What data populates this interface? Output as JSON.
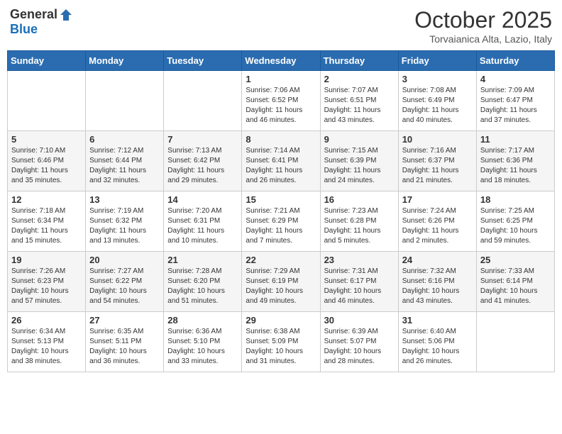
{
  "header": {
    "logo_general": "General",
    "logo_blue": "Blue",
    "month_title": "October 2025",
    "location": "Torvaianica Alta, Lazio, Italy"
  },
  "weekdays": [
    "Sunday",
    "Monday",
    "Tuesday",
    "Wednesday",
    "Thursday",
    "Friday",
    "Saturday"
  ],
  "weeks": [
    [
      {
        "day": "",
        "info": ""
      },
      {
        "day": "",
        "info": ""
      },
      {
        "day": "",
        "info": ""
      },
      {
        "day": "1",
        "info": "Sunrise: 7:06 AM\nSunset: 6:52 PM\nDaylight: 11 hours\nand 46 minutes."
      },
      {
        "day": "2",
        "info": "Sunrise: 7:07 AM\nSunset: 6:51 PM\nDaylight: 11 hours\nand 43 minutes."
      },
      {
        "day": "3",
        "info": "Sunrise: 7:08 AM\nSunset: 6:49 PM\nDaylight: 11 hours\nand 40 minutes."
      },
      {
        "day": "4",
        "info": "Sunrise: 7:09 AM\nSunset: 6:47 PM\nDaylight: 11 hours\nand 37 minutes."
      }
    ],
    [
      {
        "day": "5",
        "info": "Sunrise: 7:10 AM\nSunset: 6:46 PM\nDaylight: 11 hours\nand 35 minutes."
      },
      {
        "day": "6",
        "info": "Sunrise: 7:12 AM\nSunset: 6:44 PM\nDaylight: 11 hours\nand 32 minutes."
      },
      {
        "day": "7",
        "info": "Sunrise: 7:13 AM\nSunset: 6:42 PM\nDaylight: 11 hours\nand 29 minutes."
      },
      {
        "day": "8",
        "info": "Sunrise: 7:14 AM\nSunset: 6:41 PM\nDaylight: 11 hours\nand 26 minutes."
      },
      {
        "day": "9",
        "info": "Sunrise: 7:15 AM\nSunset: 6:39 PM\nDaylight: 11 hours\nand 24 minutes."
      },
      {
        "day": "10",
        "info": "Sunrise: 7:16 AM\nSunset: 6:37 PM\nDaylight: 11 hours\nand 21 minutes."
      },
      {
        "day": "11",
        "info": "Sunrise: 7:17 AM\nSunset: 6:36 PM\nDaylight: 11 hours\nand 18 minutes."
      }
    ],
    [
      {
        "day": "12",
        "info": "Sunrise: 7:18 AM\nSunset: 6:34 PM\nDaylight: 11 hours\nand 15 minutes."
      },
      {
        "day": "13",
        "info": "Sunrise: 7:19 AM\nSunset: 6:32 PM\nDaylight: 11 hours\nand 13 minutes."
      },
      {
        "day": "14",
        "info": "Sunrise: 7:20 AM\nSunset: 6:31 PM\nDaylight: 11 hours\nand 10 minutes."
      },
      {
        "day": "15",
        "info": "Sunrise: 7:21 AM\nSunset: 6:29 PM\nDaylight: 11 hours\nand 7 minutes."
      },
      {
        "day": "16",
        "info": "Sunrise: 7:23 AM\nSunset: 6:28 PM\nDaylight: 11 hours\nand 5 minutes."
      },
      {
        "day": "17",
        "info": "Sunrise: 7:24 AM\nSunset: 6:26 PM\nDaylight: 11 hours\nand 2 minutes."
      },
      {
        "day": "18",
        "info": "Sunrise: 7:25 AM\nSunset: 6:25 PM\nDaylight: 10 hours\nand 59 minutes."
      }
    ],
    [
      {
        "day": "19",
        "info": "Sunrise: 7:26 AM\nSunset: 6:23 PM\nDaylight: 10 hours\nand 57 minutes."
      },
      {
        "day": "20",
        "info": "Sunrise: 7:27 AM\nSunset: 6:22 PM\nDaylight: 10 hours\nand 54 minutes."
      },
      {
        "day": "21",
        "info": "Sunrise: 7:28 AM\nSunset: 6:20 PM\nDaylight: 10 hours\nand 51 minutes."
      },
      {
        "day": "22",
        "info": "Sunrise: 7:29 AM\nSunset: 6:19 PM\nDaylight: 10 hours\nand 49 minutes."
      },
      {
        "day": "23",
        "info": "Sunrise: 7:31 AM\nSunset: 6:17 PM\nDaylight: 10 hours\nand 46 minutes."
      },
      {
        "day": "24",
        "info": "Sunrise: 7:32 AM\nSunset: 6:16 PM\nDaylight: 10 hours\nand 43 minutes."
      },
      {
        "day": "25",
        "info": "Sunrise: 7:33 AM\nSunset: 6:14 PM\nDaylight: 10 hours\nand 41 minutes."
      }
    ],
    [
      {
        "day": "26",
        "info": "Sunrise: 6:34 AM\nSunset: 5:13 PM\nDaylight: 10 hours\nand 38 minutes."
      },
      {
        "day": "27",
        "info": "Sunrise: 6:35 AM\nSunset: 5:11 PM\nDaylight: 10 hours\nand 36 minutes."
      },
      {
        "day": "28",
        "info": "Sunrise: 6:36 AM\nSunset: 5:10 PM\nDaylight: 10 hours\nand 33 minutes."
      },
      {
        "day": "29",
        "info": "Sunrise: 6:38 AM\nSunset: 5:09 PM\nDaylight: 10 hours\nand 31 minutes."
      },
      {
        "day": "30",
        "info": "Sunrise: 6:39 AM\nSunset: 5:07 PM\nDaylight: 10 hours\nand 28 minutes."
      },
      {
        "day": "31",
        "info": "Sunrise: 6:40 AM\nSunset: 5:06 PM\nDaylight: 10 hours\nand 26 minutes."
      },
      {
        "day": "",
        "info": ""
      }
    ]
  ]
}
